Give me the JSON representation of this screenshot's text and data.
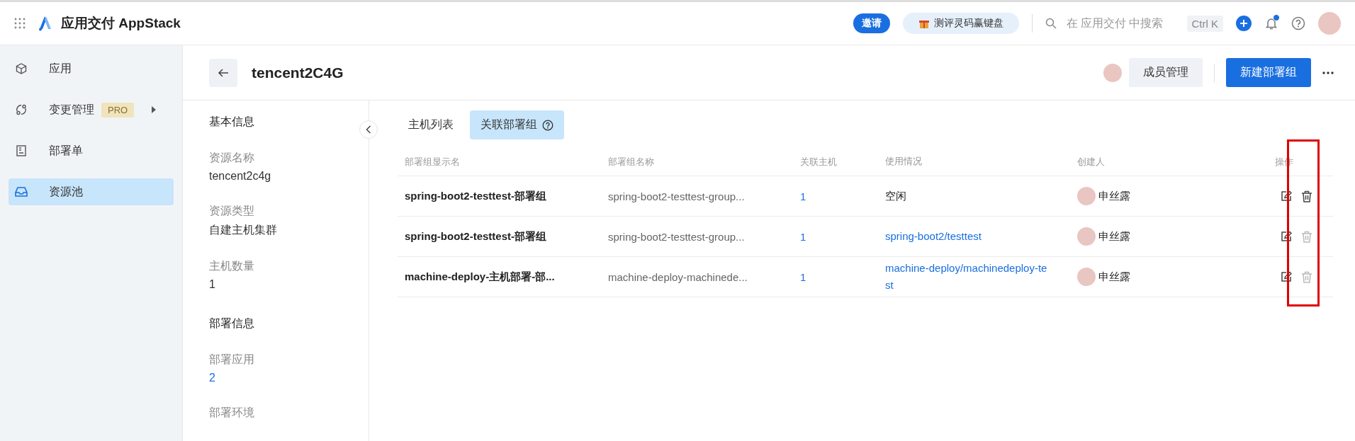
{
  "topbar": {
    "brand": "应用交付 AppStack",
    "invite": "邀请",
    "promo": "测评灵码赢键盘",
    "search_placeholder": "在 应用交付 中搜索",
    "shortcut": "Ctrl K",
    "notification_dot": true
  },
  "sidebar": {
    "items": [
      {
        "label": "应用",
        "selected": false
      },
      {
        "label": "变更管理",
        "badge": "PRO",
        "expandable": true,
        "selected": false
      },
      {
        "label": "部署单",
        "selected": false
      },
      {
        "label": "资源池",
        "selected": true
      }
    ]
  },
  "header": {
    "title": "tencent2C4G",
    "members_button": "成员管理",
    "primary_button": "新建部署组"
  },
  "info_panel": {
    "sections": [
      {
        "title": "基本信息",
        "fields": [
          {
            "label": "资源名称",
            "value": "tencent2c4g",
            "kind": "text"
          },
          {
            "label": "资源类型",
            "value": "自建主机集群",
            "kind": "text"
          },
          {
            "label": "主机数量",
            "value": "1",
            "kind": "text"
          }
        ]
      },
      {
        "title": "部署信息",
        "fields": [
          {
            "label": "部署应用",
            "value": "2",
            "kind": "link"
          },
          {
            "label": "部署环境"
          }
        ]
      }
    ]
  },
  "tabs": [
    {
      "label": "主机列表",
      "selected": false,
      "help": false
    },
    {
      "label": "关联部署组",
      "selected": true,
      "help": true
    }
  ],
  "table": {
    "columns": [
      "部署组显示名",
      "部署组名称",
      "关联主机",
      "使用情况",
      "创建人",
      "操作"
    ],
    "rows": [
      {
        "display_name": "spring-boot2-testtest-部署组",
        "name": "spring-boot2-testtest-group...",
        "hosts": "1",
        "usage": "空闲",
        "usage_is_link": false,
        "creator": "申丝露",
        "delete_disabled": false
      },
      {
        "display_name": "spring-boot2-testtest-部署组",
        "name": "spring-boot2-testtest-group...",
        "hosts": "1",
        "usage": "spring-boot2/testtest",
        "usage_is_link": true,
        "creator": "申丝露",
        "delete_disabled": true
      },
      {
        "display_name": "machine-deploy-主机部署-部...",
        "name": "machine-deploy-machinede...",
        "hosts": "1",
        "usage": "machine-deploy/machinedeploy-test",
        "usage_is_link": true,
        "creator": "申丝露",
        "delete_disabled": true
      }
    ]
  }
}
